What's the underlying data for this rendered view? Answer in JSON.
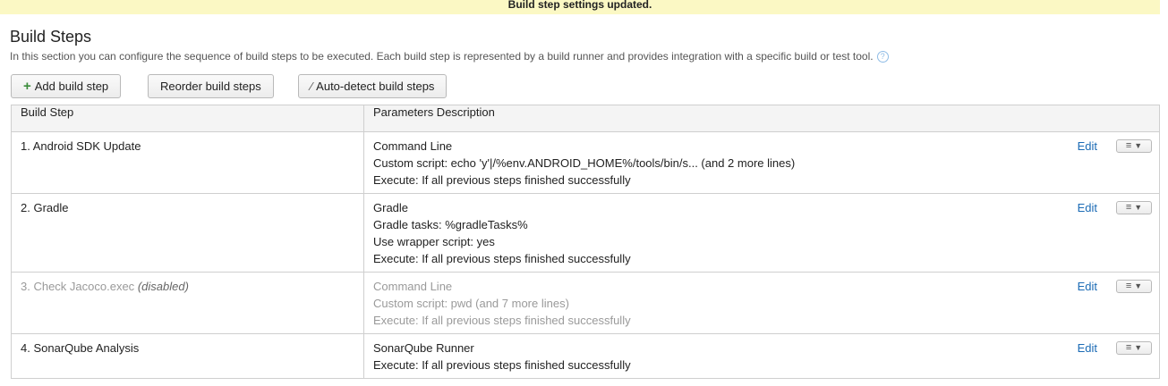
{
  "banner": "Build step settings updated.",
  "page_title": "Build Steps",
  "description": "In this section you can configure the sequence of build steps to be executed. Each build step is represented by a build runner and provides integration with a specific build or test tool.",
  "help_icon": "?",
  "buttons": {
    "add": "Add build step",
    "reorder": "Reorder build steps",
    "autodetect": "Auto-detect build steps"
  },
  "table": {
    "headers": [
      "Build Step",
      "Parameters Description"
    ],
    "rows": [
      {
        "name": "1. Android SDK Update",
        "lines": [
          "Command Line",
          "Custom script: echo 'y'|/%env.ANDROID_HOME%/tools/bin/s... (and 2 more lines)",
          "Execute: If all previous steps finished successfully"
        ],
        "edit": "Edit"
      },
      {
        "name": "2. Gradle",
        "lines": [
          "Gradle",
          "Gradle tasks: %gradleTasks%",
          "Use wrapper script: yes",
          "Execute: If all previous steps finished successfully"
        ],
        "edit": "Edit"
      },
      {
        "name": "3. Check Jacoco.exec",
        "disabled_tag": "(disabled)",
        "lines": [
          "Command Line",
          "Custom script: pwd (and 7 more lines)",
          "Execute: If all previous steps finished successfully"
        ],
        "edit": "Edit"
      },
      {
        "name": "4. SonarQube Analysis",
        "lines": [
          "SonarQube Runner",
          "Execute: If all previous steps finished successfully"
        ],
        "edit": "Edit"
      }
    ]
  },
  "icons": {
    "add": "plus-icon",
    "autodetect": "magic-wand-icon",
    "menu": "list-icon"
  },
  "colors": {
    "banner_bg": "#fbf8c4",
    "link": "#1b6bb5",
    "disabled_text": "#9a9a9a"
  }
}
